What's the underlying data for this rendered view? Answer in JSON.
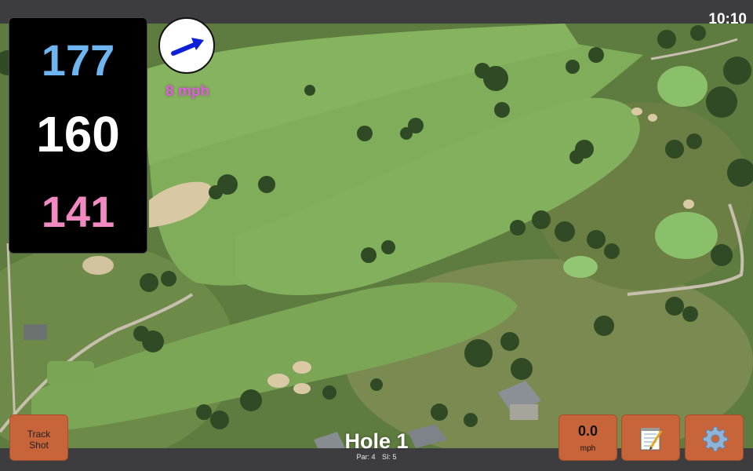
{
  "status": {
    "time": "10:10"
  },
  "yardages": {
    "back": "177",
    "middle": "160",
    "front": "141"
  },
  "wind": {
    "speed_label": "8 mph",
    "direction_icon": "arrow-right-icon"
  },
  "hole": {
    "title": "Hole 1",
    "par": "Par: 4",
    "stroke_index": "SI: 5"
  },
  "buttons": {
    "track_shot": "Track\nShot",
    "wind_speed_value": "0.0",
    "wind_speed_unit": "mph",
    "notes_icon": "notepad-icon",
    "settings_icon": "gear-icon"
  },
  "colors": {
    "back_yardage": "#6eb4ee",
    "middle_yardage": "#ffffff",
    "front_yardage": "#f28ac2",
    "wind_label": "#e05ce0",
    "button": "#c8643a"
  }
}
